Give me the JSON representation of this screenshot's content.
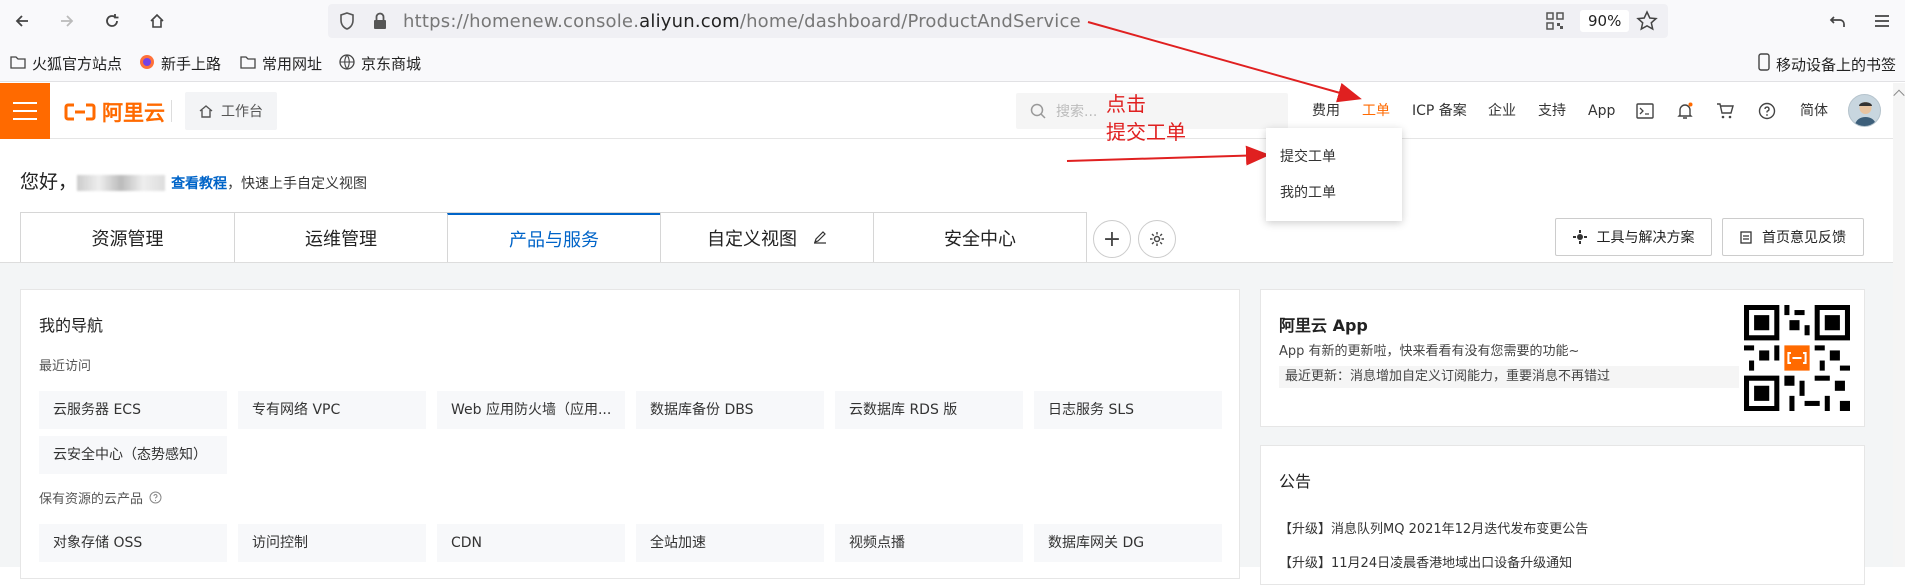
{
  "browser": {
    "url_prefix": "https://homenew.console.",
    "url_domain": "aliyun.com",
    "url_path": "/home/dashboard/ProductAndService",
    "zoom": "90%"
  },
  "bookmarks": [
    "火狐官方站点",
    "新手上路",
    "常用网址",
    "京东商城"
  ],
  "bookmarks_mobile": "移动设备上的书签",
  "header": {
    "brand": "阿里云",
    "workbench": "工作台",
    "search_placeholder": "搜索...",
    "nav": [
      "费用",
      "工单",
      "ICP 备案",
      "企业",
      "支持",
      "App"
    ],
    "lang": "简体"
  },
  "annotation": {
    "line1": "点击",
    "line2": "提交工单"
  },
  "dropdown": {
    "items": [
      "提交工单",
      "我的工单"
    ]
  },
  "greeting": {
    "hello": "您好，",
    "link": "查看教程",
    "rest": "，快速上手自定义视图"
  },
  "tabs": [
    "资源管理",
    "运维管理",
    "产品与服务",
    "自定义视图",
    "安全中心"
  ],
  "actions": {
    "tools": "工具与解决方案",
    "feedback": "首页意见反馈"
  },
  "nav_card": {
    "title": "我的导航",
    "recent_label": "最近访问",
    "recent": [
      "云服务器 ECS",
      "专有网络 VPC",
      "Web 应用防火墙（应用...",
      "数据库备份 DBS",
      "云数据库 RDS 版",
      "日志服务 SLS",
      "云安全中心（态势感知）"
    ],
    "owned_label": "保有资源的云产品",
    "owned": [
      "对象存储 OSS",
      "访问控制",
      "CDN",
      "全站加速",
      "视频点播",
      "数据库网关 DG"
    ]
  },
  "app_card": {
    "title": "阿里云 App",
    "desc": "App 有新的更新啦，快来看看有没有您需要的功能~",
    "update": "最近更新：消息增加自定义订阅能力，重要消息不再错过"
  },
  "notice_card": {
    "title": "公告",
    "items": [
      "【升级】消息队列MQ 2021年12月迭代发布变更公告",
      "【升级】11月24日凌晨香港地域出口设备升级通知"
    ]
  },
  "colors": {
    "brand": "#ff6a00",
    "link": "#0064c8",
    "annotation": "#e02020"
  }
}
